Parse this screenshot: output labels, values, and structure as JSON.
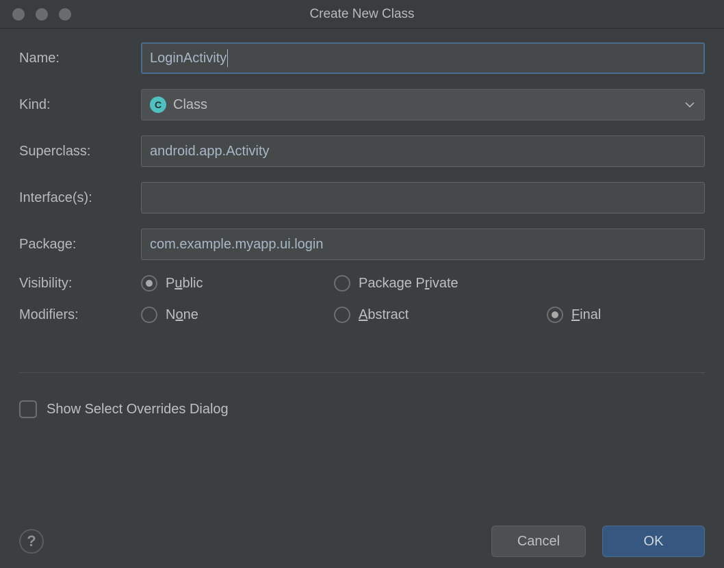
{
  "window": {
    "title": "Create New Class"
  },
  "form": {
    "name_label": "Name:",
    "name_value": "LoginActivity",
    "kind_label": "Kind:",
    "kind_value": "Class",
    "kind_icon_char": "C",
    "superclass_label": "Superclass:",
    "superclass_value": "android.app.Activity",
    "interfaces_label": "Interface(s):",
    "interfaces_value": "",
    "package_label": "Package:",
    "package_value": "com.example.myapp.ui.login",
    "visibility_label": "Visibility:",
    "visibility": {
      "public": "Public",
      "package_private": "Package Private",
      "selected": "public"
    },
    "modifiers_label": "Modifiers:",
    "modifiers": {
      "none": "None",
      "abstract": "Abstract",
      "final": "Final",
      "selected": "final"
    }
  },
  "checkbox": {
    "label": "Show Select Overrides Dialog",
    "checked": false
  },
  "buttons": {
    "cancel": "Cancel",
    "ok": "OK",
    "help": "?"
  }
}
